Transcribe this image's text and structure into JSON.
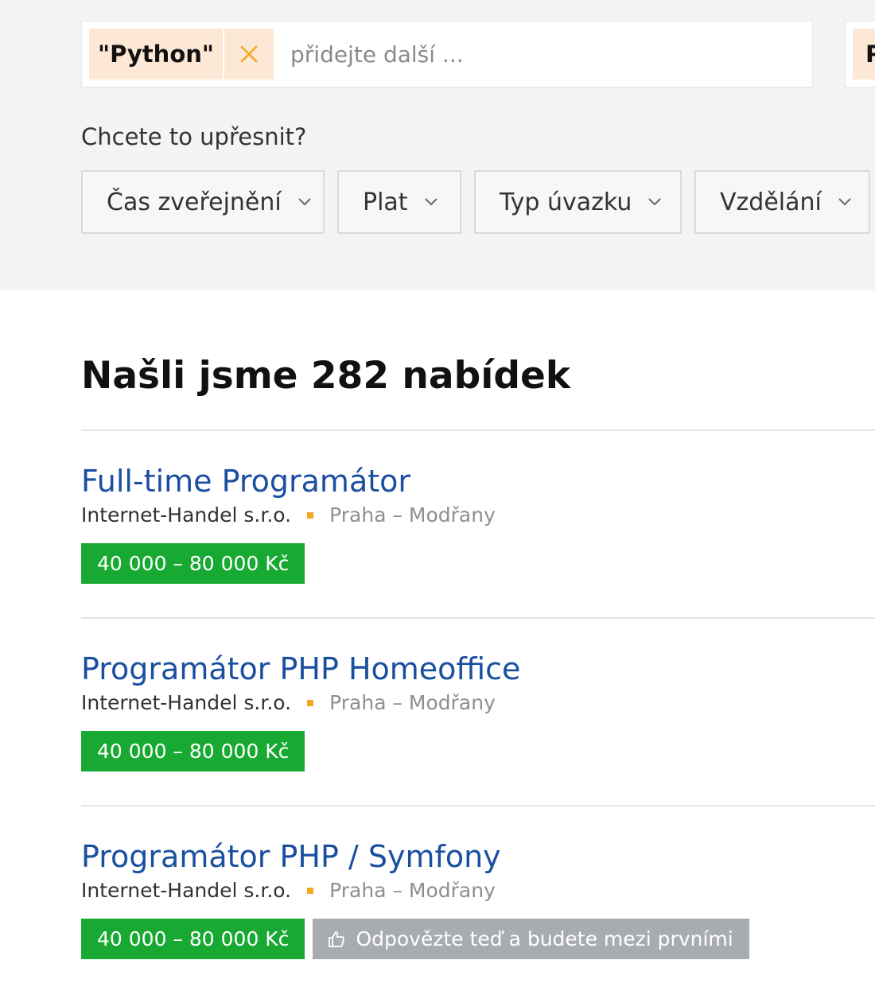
{
  "search": {
    "tag_label": "\"Python\"",
    "input_placeholder": "přidejte další ...",
    "second_tag_label": "P"
  },
  "refine": {
    "label": "Chcete to upřesnit?",
    "filters": [
      {
        "label": "Čas zveřejnění"
      },
      {
        "label": "Plat"
      },
      {
        "label": "Typ úvazku"
      },
      {
        "label": "Vzdělání"
      }
    ]
  },
  "results": {
    "prefix": "Našli jsme",
    "count": "282",
    "suffix": "nabídek"
  },
  "jobs": [
    {
      "title": "Full-time Programátor",
      "company": "Internet-Handel s.r.o.",
      "location": "Praha – Modřany",
      "salary": "40 000 – 80 000 Kč"
    },
    {
      "title": "Programátor PHP Homeoffice",
      "company": "Internet-Handel s.r.o.",
      "location": "Praha – Modřany",
      "salary": "40 000 – 80 000 Kč"
    },
    {
      "title": "Programátor PHP / Symfony",
      "company": "Internet-Handel s.r.o.",
      "location": "Praha – Modřany",
      "salary": "40 000 – 80 000 Kč",
      "respond_label": "Odpovězte teď a budete mezi prvními"
    }
  ],
  "colors": {
    "tag_bg": "#fde8d5",
    "tag_remove": "#f5a623",
    "link": "#1a4fa0",
    "salary_bg": "#18a933",
    "respond_bg": "#a8acb0",
    "separator": "#f5a623"
  },
  "icons": {
    "tag_remove": "close-icon",
    "filter_chevron": "chevron-down-icon",
    "respond": "thumbs-up-icon"
  }
}
